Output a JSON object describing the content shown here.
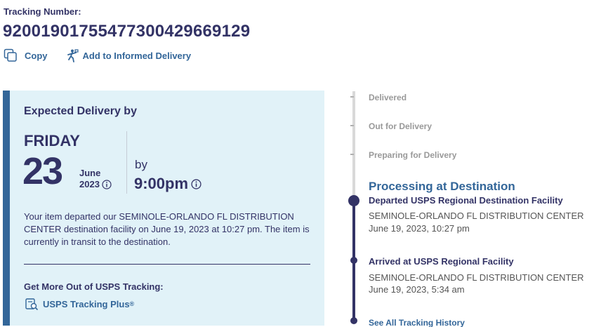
{
  "tracking": {
    "label": "Tracking Number:",
    "number": "9200190175547730042966912 9"
  },
  "actions": {
    "copy_label": "Copy",
    "informed_label": "Add to Informed Delivery"
  },
  "delivery": {
    "heading": "Expected Delivery by",
    "day_of_week": "FRIDAY",
    "date": "23",
    "month": "June",
    "year": "2023",
    "by_label": "by",
    "time": "9:00pm",
    "description": "Your item departed our SEMINOLE-ORLANDO FL DISTRIBUTION CENTER destination facility on June 19, 2023 at 10:27 pm. The item is currently in transit to the destination.",
    "more_title": "Get More Out of USPS Tracking:",
    "plus_label": "USPS Tracking Plus",
    "plus_mark": "®"
  },
  "timeline": {
    "steps": [
      "Delivered",
      "Out for Delivery",
      "Preparing for Delivery"
    ],
    "current_status": "Processing at Destination",
    "events": [
      {
        "title": "Departed USPS Regional Destination Facility",
        "location": "SEMINOLE-ORLANDO FL DISTRIBUTION CENTER",
        "time": "June 19, 2023, 10:27 pm"
      },
      {
        "title": "Arrived at USPS Regional Facility",
        "location": "SEMINOLE-ORLANDO FL DISTRIBUTION CENTER",
        "time": "June 19, 2023, 5:34 am"
      }
    ],
    "see_all_label": "See All Tracking History"
  },
  "colors": {
    "navy": "#333366",
    "link_blue": "#336699",
    "panel_bg": "#e1f2f8",
    "muted_gray": "#999999"
  },
  "icons": [
    "copy-icon",
    "informed-delivery-icon",
    "info-icon",
    "tracking-plus-icon"
  ]
}
